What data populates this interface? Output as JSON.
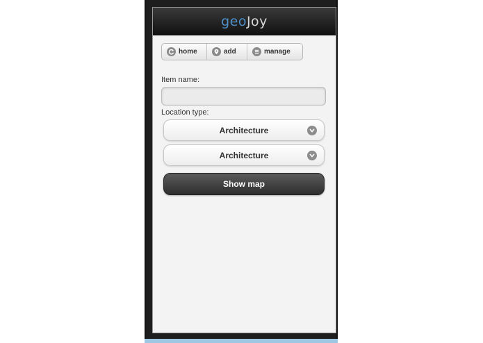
{
  "app": {
    "logo_part1": "geo",
    "logo_part2": "Joy"
  },
  "nav": {
    "items": [
      {
        "label": "home",
        "icon": "home-icon"
      },
      {
        "label": "add",
        "icon": "location-pin-icon"
      },
      {
        "label": "manage",
        "icon": "list-icon"
      }
    ]
  },
  "form": {
    "item_name_label": "Item name:",
    "item_name_value": "",
    "location_type_label": "Location type:",
    "select_1_value": "Architecture",
    "select_2_value": "Architecture",
    "show_map_label": "Show map"
  },
  "colors": {
    "logo_accent": "#4f8fc8",
    "header_bg": "#1a1a1a",
    "primary_button": "#3a3a3a"
  }
}
